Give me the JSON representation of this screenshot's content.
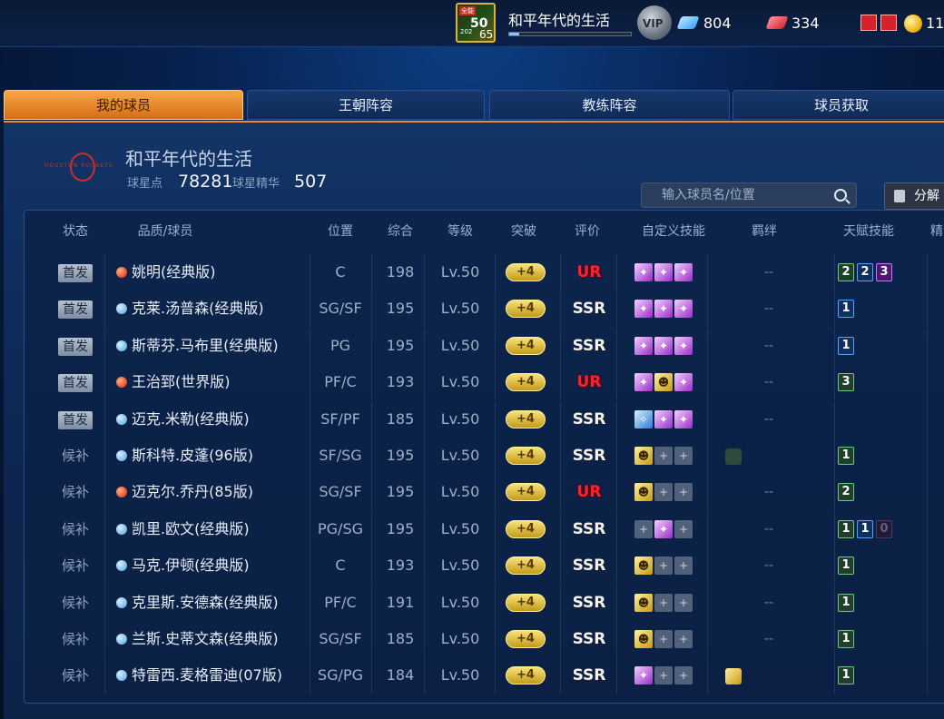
{
  "topbar": {
    "badge_tag": "全能",
    "level": "50",
    "level_sub": "202",
    "level_num": "65",
    "player_name": "和平年代的生活",
    "vip_label": "VIP",
    "diamonds": "804",
    "tickets": "334",
    "gold": "11"
  },
  "tabs": [
    "我的球员",
    "王朝阵容",
    "教练阵容",
    "球员获取"
  ],
  "team": {
    "name": "和平年代的生活",
    "logo_text": "HOUSTON ROCKETS",
    "star_points_label": "球星点",
    "star_points": "78281",
    "star_essence_label": "球星精华",
    "star_essence": "507"
  },
  "search": {
    "placeholder": "输入球员名/位置"
  },
  "decompose_label": "分解",
  "columns": [
    "状态",
    "品质/球员",
    "位置",
    "综合",
    "等级",
    "突破",
    "评价",
    "自定义技能",
    "羁绊",
    "天赋技能",
    "精"
  ],
  "rows": [
    {
      "status": "首发",
      "quality": "ur",
      "name": "姚明(经典版)",
      "pos": "C",
      "overall": "198",
      "level": "Lv.50",
      "break": "+4",
      "rating": "UR",
      "skills": [
        "purple",
        "purple",
        "purple"
      ],
      "bond": "--",
      "talents": [
        [
          "2",
          "green"
        ],
        [
          "2",
          "blue"
        ],
        [
          "3",
          "purple"
        ]
      ]
    },
    {
      "status": "首发",
      "quality": "ssr",
      "name": "克莱.汤普森(经典版)",
      "pos": "SG/SF",
      "overall": "195",
      "level": "Lv.50",
      "break": "+4",
      "rating": "SSR",
      "skills": [
        "purple",
        "purple",
        "purple"
      ],
      "bond": "--",
      "talents": [
        [
          "1",
          "blue"
        ]
      ]
    },
    {
      "status": "首发",
      "quality": "ssr",
      "name": "斯蒂芬.马布里(经典版)",
      "pos": "PG",
      "overall": "195",
      "level": "Lv.50",
      "break": "+4",
      "rating": "SSR",
      "skills": [
        "purple",
        "purple",
        "purple"
      ],
      "bond": "--",
      "talents": [
        [
          "1",
          "blue"
        ]
      ]
    },
    {
      "status": "首发",
      "quality": "ur",
      "name": "王治郅(世界版)",
      "pos": "PF/C",
      "overall": "193",
      "level": "Lv.50",
      "break": "+4",
      "rating": "UR",
      "skills": [
        "purple",
        "gold",
        "purple"
      ],
      "bond": "--",
      "talents": [
        [
          "3",
          "green"
        ]
      ]
    },
    {
      "status": "首发",
      "quality": "ssr",
      "name": "迈克.米勒(经典版)",
      "pos": "SF/PF",
      "overall": "185",
      "level": "Lv.50",
      "break": "+4",
      "rating": "SSR",
      "skills": [
        "blue",
        "purple",
        "purple"
      ],
      "bond": "--",
      "talents": []
    },
    {
      "status": "候补",
      "quality": "ssr",
      "name": "斯科特.皮蓬(96版)",
      "pos": "SF/SG",
      "overall": "195",
      "level": "Lv.50",
      "break": "+4",
      "rating": "SSR",
      "skills": [
        "gold",
        "empty",
        "empty"
      ],
      "bond": "",
      "bond_icon": "bull",
      "talents": [
        [
          "1",
          "green"
        ]
      ]
    },
    {
      "status": "候补",
      "quality": "ur",
      "name": "迈克尔.乔丹(85版)",
      "pos": "SG/SF",
      "overall": "195",
      "level": "Lv.50",
      "break": "+4",
      "rating": "UR",
      "skills": [
        "gold",
        "empty",
        "empty"
      ],
      "bond": "--",
      "talents": [
        [
          "2",
          "green"
        ]
      ]
    },
    {
      "status": "候补",
      "quality": "ssr",
      "name": "凯里.欧文(经典版)",
      "pos": "PG/SG",
      "overall": "195",
      "level": "Lv.50",
      "break": "+4",
      "rating": "SSR",
      "skills": [
        "empty",
        "purple",
        "empty"
      ],
      "bond": "--",
      "talents": [
        [
          "1",
          "green"
        ],
        [
          "1",
          "blue"
        ],
        [
          "0",
          "dim"
        ]
      ]
    },
    {
      "status": "候补",
      "quality": "ssr",
      "name": "马克.伊顿(经典版)",
      "pos": "C",
      "overall": "193",
      "level": "Lv.50",
      "break": "+4",
      "rating": "SSR",
      "skills": [
        "gold",
        "empty",
        "empty"
      ],
      "bond": "--",
      "talents": [
        [
          "1",
          "green"
        ]
      ]
    },
    {
      "status": "候补",
      "quality": "ssr",
      "name": "克里斯.安德森(经典版)",
      "pos": "PF/C",
      "overall": "191",
      "level": "Lv.50",
      "break": "+4",
      "rating": "SSR",
      "skills": [
        "gold",
        "empty",
        "empty"
      ],
      "bond": "--",
      "talents": [
        [
          "1",
          "green"
        ]
      ]
    },
    {
      "status": "候补",
      "quality": "ssr",
      "name": "兰斯.史蒂文森(经典版)",
      "pos": "SG/SF",
      "overall": "185",
      "level": "Lv.50",
      "break": "+4",
      "rating": "SSR",
      "skills": [
        "gold",
        "empty",
        "empty"
      ],
      "bond": "--",
      "talents": [
        [
          "1",
          "green"
        ]
      ]
    },
    {
      "status": "候补",
      "quality": "ssr",
      "name": "特雷西.麦格雷迪(07版)",
      "pos": "SG/PG",
      "overall": "184",
      "level": "Lv.50",
      "break": "+4",
      "rating": "SSR",
      "skills": [
        "purple",
        "empty",
        "empty"
      ],
      "bond": "",
      "bond_icon": "gold-link",
      "talents": [
        [
          "1",
          "green"
        ]
      ]
    }
  ],
  "colors": {
    "accent_orange": "#e98b2a",
    "ur_red": "#ff2030",
    "panel_blue": "#0c2650"
  }
}
